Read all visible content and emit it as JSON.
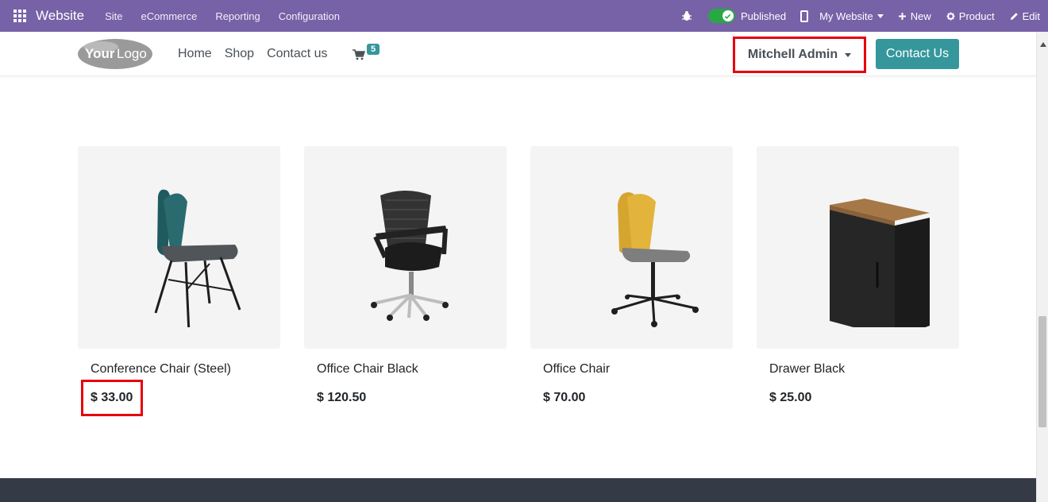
{
  "topbar": {
    "brand": "Website",
    "menu": [
      "Site",
      "eCommerce",
      "Reporting",
      "Configuration"
    ],
    "published_label": "Published",
    "my_website_label": "My Website",
    "new_label": "New",
    "product_label": "Product",
    "edit_label": "Edit",
    "published": true,
    "color": "#7761a7"
  },
  "header": {
    "logo_text": "YourLogo",
    "nav": [
      "Home",
      "Shop",
      "Contact us"
    ],
    "cart_count": "5",
    "user_name": "Mitchell Admin",
    "contact_button": "Contact Us",
    "accent_color": "#35979c"
  },
  "products": [
    {
      "name": "Conference Chair (Steel)",
      "price": "$ 33.00",
      "icon": "teal-shell-chair"
    },
    {
      "name": "Office Chair Black",
      "price": "$ 120.50",
      "icon": "black-mesh-office-chair"
    },
    {
      "name": "Office Chair",
      "price": "$ 70.00",
      "icon": "yellow-swivel-chair"
    },
    {
      "name": "Drawer Black",
      "price": "$ 25.00",
      "icon": "black-drawer-cabinet"
    }
  ],
  "highlights": {
    "color": "#e8000b",
    "items": [
      "user-menu",
      "first-product-price"
    ]
  }
}
